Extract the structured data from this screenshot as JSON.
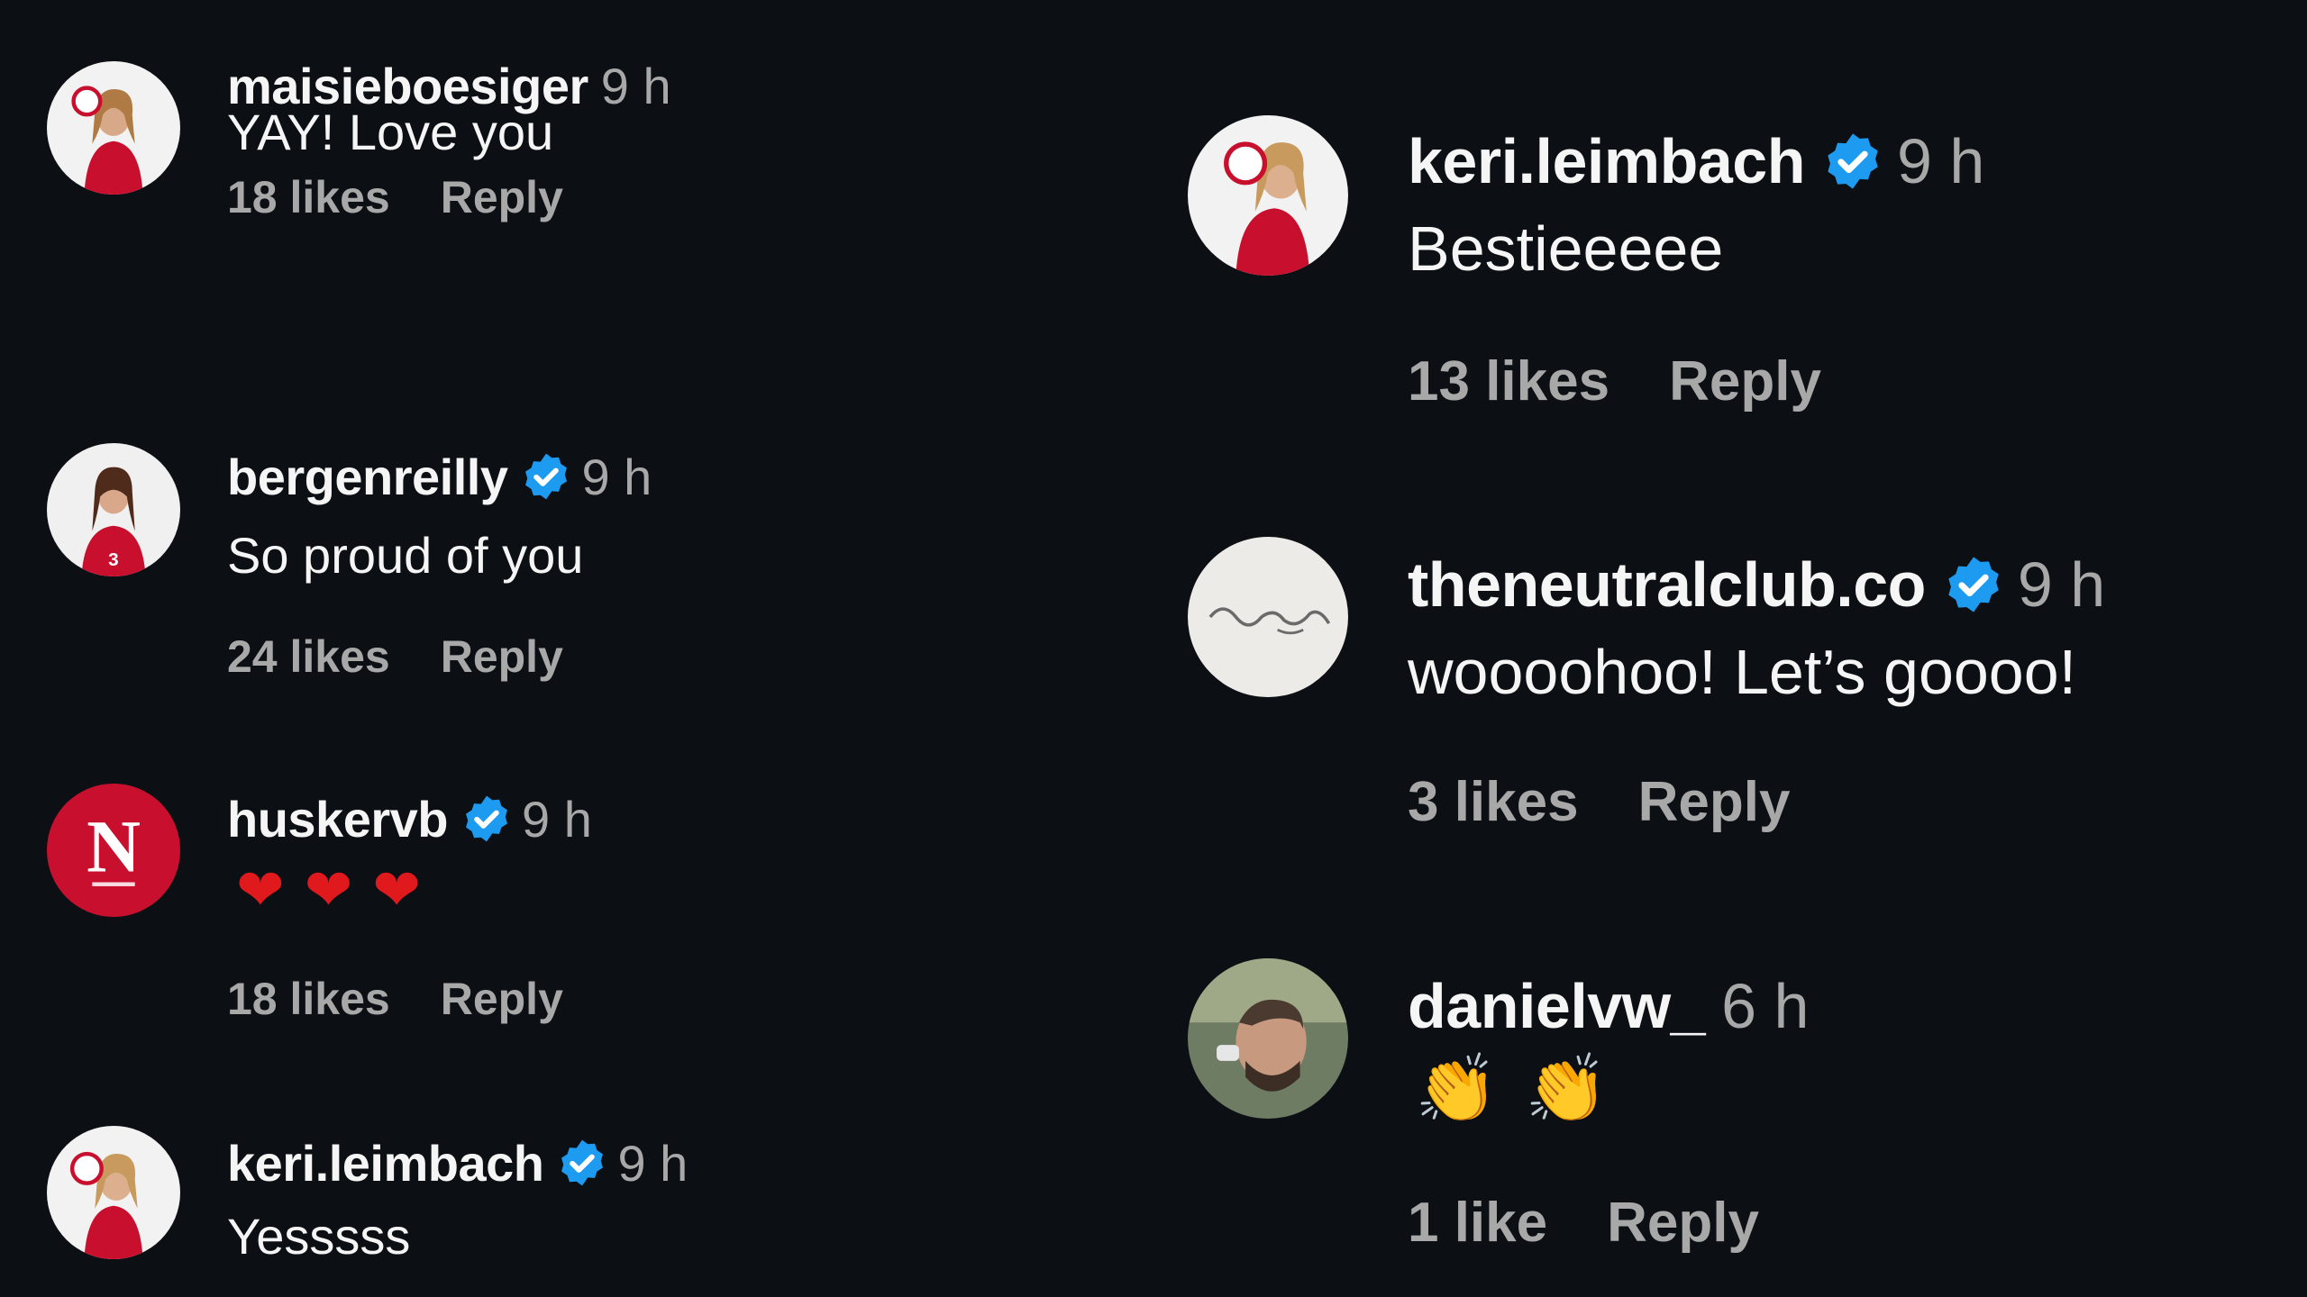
{
  "colors": {
    "background": "#0c0f14",
    "text": "#f5f5f5",
    "muted": "#a8a8a8",
    "verified": "#1d9bf0",
    "heart": "#e0191d",
    "nebraska_red": "#c8102e"
  },
  "left_comments": [
    {
      "username": "maisieboesiger",
      "verified": false,
      "time": "9 h",
      "text": "YAY! Love you",
      "likes": "18 likes",
      "reply": "Reply",
      "avatar_icon": "player-photo-avatar"
    },
    {
      "username": "bergenreilly",
      "verified": true,
      "time": "9 h",
      "text": "So proud of you",
      "likes": "24 likes",
      "reply": "Reply",
      "avatar_icon": "player-photo-avatar"
    },
    {
      "username": "huskervb",
      "verified": true,
      "time": "9 h",
      "text": "",
      "emoji": [
        "❤",
        "❤",
        "❤"
      ],
      "likes": "18 likes",
      "reply": "Reply",
      "avatar_icon": "nebraska-n-logo"
    },
    {
      "username": "keri.leimbach",
      "verified": true,
      "time": "9 h",
      "text": "Yesssss",
      "avatar_icon": "player-photo-avatar"
    }
  ],
  "right_comments": [
    {
      "username": "keri.leimbach",
      "verified": true,
      "time": "9 h",
      "text": "Bestieeeee",
      "likes": "13 likes",
      "reply": "Reply",
      "avatar_icon": "player-photo-avatar"
    },
    {
      "username": "theneutralclub.co",
      "verified": true,
      "time": "9 h",
      "text": "woooohoo! Let’s goooo!",
      "likes": "3 likes",
      "reply": "Reply",
      "avatar_icon": "script-logo-avatar"
    },
    {
      "username": "danielvw_",
      "verified": false,
      "time": "6 h",
      "text": "",
      "emoji": [
        "👏",
        "👏"
      ],
      "likes": "1 like",
      "reply": "Reply",
      "avatar_icon": "man-photo-avatar"
    }
  ]
}
